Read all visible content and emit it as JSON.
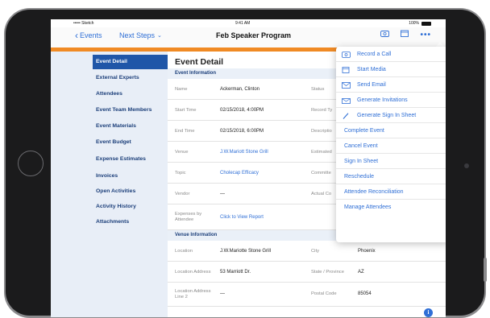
{
  "status_bar": {
    "carrier": "••••• Sketch",
    "time": "9:41 AM",
    "battery": "100%"
  },
  "nav": {
    "back_label": "Events",
    "next_steps_label": "Next Steps",
    "title": "Feb Speaker Program"
  },
  "sidebar": {
    "items": [
      {
        "label": "Event Detail",
        "active": true
      },
      {
        "label": "External Experts"
      },
      {
        "label": "Attendees"
      },
      {
        "label": "Event Team Members"
      },
      {
        "label": "Event Materials"
      },
      {
        "label": "Event Budget"
      },
      {
        "label": "Expense Estimates"
      },
      {
        "label": "Invoices"
      },
      {
        "label": "Open Activities"
      },
      {
        "label": "Activity History"
      },
      {
        "label": "Attachments"
      }
    ]
  },
  "main": {
    "title": "Event Detail",
    "event_info_header": "Event Information",
    "event_info": [
      {
        "label": "Name",
        "value": "Ackerman, Clinton",
        "right_label": "Status"
      },
      {
        "label": "Start Time",
        "value": "02/15/2018, 4:00PM",
        "right_label": "Record Ty"
      },
      {
        "label": "End Time",
        "value": "02/15/2018, 6:00PM",
        "right_label": "Descriptio"
      },
      {
        "label": "Venue",
        "value": "J.W.Mariott Stone Grill",
        "right_label": "Estimated"
      },
      {
        "label": "Topic",
        "value": "Cholecap Efficacy",
        "right_label": "Committe"
      },
      {
        "label": "Vendor",
        "value": "—",
        "right_label": "Actual Co"
      },
      {
        "label": "Expenses by Attendee",
        "value": "Click to View Report",
        "right_label": ""
      }
    ],
    "venue_info_header": "Venue Information",
    "venue_info": [
      {
        "label": "Location",
        "value": "J.W.Mariotte Stone Grill",
        "right_label": "City",
        "right_value": "Phoenix"
      },
      {
        "label": "Location Address",
        "value": "53 Marriott Dr.",
        "right_label": "State / Province",
        "right_value": "AZ"
      },
      {
        "label": "Location Address Line 2",
        "value": "—",
        "right_label": "Postal Code",
        "right_value": "85054"
      }
    ]
  },
  "popover": {
    "items": [
      {
        "label": "Record a Call",
        "icon": "record-call-icon"
      },
      {
        "label": "Start Media",
        "icon": "media-icon"
      },
      {
        "label": "Send Email",
        "icon": "email-icon"
      },
      {
        "label": "Generate Invitations",
        "icon": "invitation-icon"
      },
      {
        "label": "Generate Sign In Sheet",
        "icon": "pen-icon"
      },
      {
        "label": "Complete Event"
      },
      {
        "label": "Cancel Event"
      },
      {
        "label": "Sign In Sheet"
      },
      {
        "label": "Reschedule"
      },
      {
        "label": "Attendee Reconciliation"
      },
      {
        "label": "Manage Attendees"
      }
    ]
  },
  "colors": {
    "accent_orange": "#f08a24",
    "link_blue": "#2f6fd6",
    "active_sidebar": "#1f56a8",
    "sidebar_bg": "#e8eef7"
  }
}
